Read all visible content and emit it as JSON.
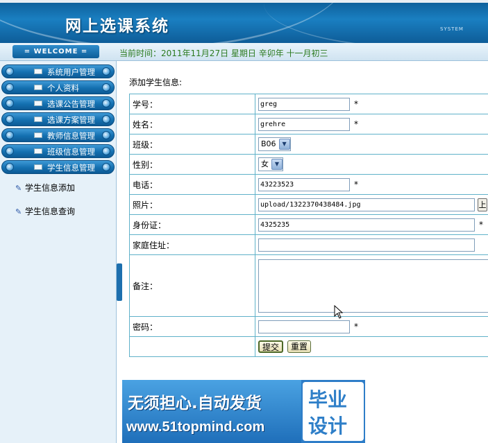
{
  "header": {
    "title": "网上选课系统",
    "system_tag": "SYSTEM"
  },
  "welcome": {
    "badge": "= WELCOME =",
    "datetime": "当前时间：2011年11月27日 星期日 辛卯年 十一月初三"
  },
  "sidebar": {
    "items": [
      {
        "label": "系统用户管理"
      },
      {
        "label": "个人资料"
      },
      {
        "label": "选课公告管理"
      },
      {
        "label": "选课方案管理"
      },
      {
        "label": "教师信息管理"
      },
      {
        "label": "班级信息管理"
      },
      {
        "label": "学生信息管理"
      }
    ],
    "subitems": [
      {
        "label": "学生信息添加"
      },
      {
        "label": "学生信息查询"
      }
    ]
  },
  "form": {
    "title": "添加学生信息:",
    "fields": {
      "xuehao": {
        "label": "学号：",
        "value": "greg",
        "required": "*"
      },
      "name": {
        "label": "姓名：",
        "value": "grehre",
        "required": "*"
      },
      "class": {
        "label": "班级：",
        "value": "B06"
      },
      "gender": {
        "label": "性别：",
        "value": "女"
      },
      "phone": {
        "label": "电话：",
        "value": "43223523",
        "required": "*"
      },
      "photo": {
        "label": "照片：",
        "value": "upload/1322370438484.jpg",
        "upload_label": "上"
      },
      "idcard": {
        "label": "身份证：",
        "value": "4325235",
        "required": "*"
      },
      "address": {
        "label": "家庭住址：",
        "value": ""
      },
      "remark": {
        "label": "备注：",
        "value": ""
      },
      "password": {
        "label": "密码：",
        "value": "",
        "required": "*"
      }
    },
    "submit_label": "提交",
    "reset_label": "重置"
  },
  "ad": {
    "line1": "无须担心.自动发货",
    "line2": "www.51topmind.com",
    "right_top": "毕业",
    "right_bottom": "设计"
  }
}
